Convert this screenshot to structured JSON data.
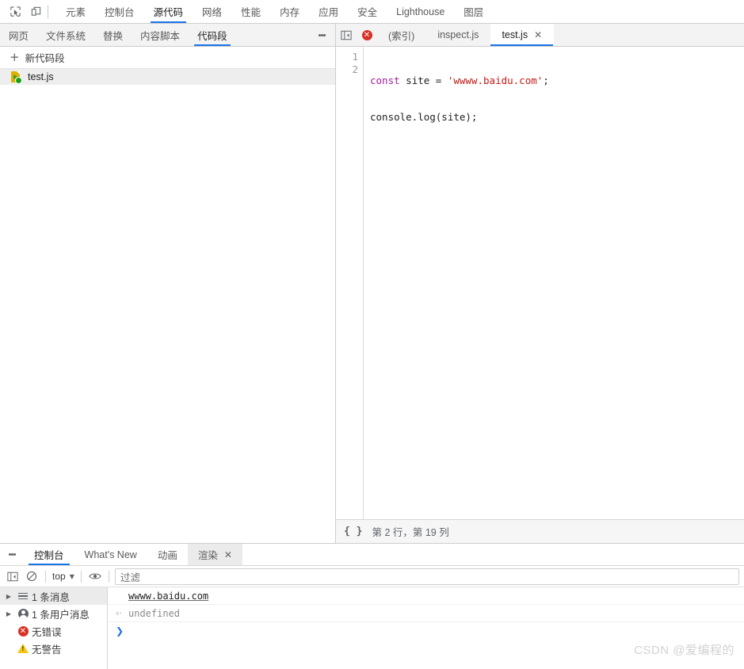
{
  "toolbar": {
    "inspect_icon": "inspect-cursor-icon",
    "device_icon": "device-toolbar-icon"
  },
  "main_tabs": [
    {
      "label": "元素",
      "active": false
    },
    {
      "label": "控制台",
      "active": false
    },
    {
      "label": "源代码",
      "active": true
    },
    {
      "label": "网络",
      "active": false
    },
    {
      "label": "性能",
      "active": false
    },
    {
      "label": "内存",
      "active": false
    },
    {
      "label": "应用",
      "active": false
    },
    {
      "label": "安全",
      "active": false
    },
    {
      "label": "Lighthouse",
      "active": false
    },
    {
      "label": "图层",
      "active": false
    }
  ],
  "navigator": {
    "sub_tabs": [
      {
        "label": "网页",
        "active": false
      },
      {
        "label": "文件系统",
        "active": false
      },
      {
        "label": "替换",
        "active": false
      },
      {
        "label": "内容脚本",
        "active": false
      },
      {
        "label": "代码段",
        "active": true
      }
    ],
    "more_icon": "kebab-menu-icon",
    "new_snippet_label": "新代码段",
    "plus_icon": "plus-icon",
    "files": [
      {
        "name": "test.js",
        "icon": "js-snippet-icon",
        "selected": true
      }
    ]
  },
  "editor": {
    "panel_toggle_icon": "show-navigator-icon",
    "error_badge_icon": "error-circle-icon",
    "tabs": [
      {
        "label": "(索引)",
        "active": false,
        "closable": false
      },
      {
        "label": "inspect.js",
        "active": false,
        "closable": false
      },
      {
        "label": "test.js",
        "active": true,
        "closable": true,
        "close_icon": "close-icon"
      }
    ],
    "line_numbers": [
      "1",
      "2"
    ],
    "code": {
      "line1": {
        "keyword": "const",
        "ident": " site = ",
        "string": "'wwww.baidu.com'",
        "tail": ";"
      },
      "line2": {
        "text": "console.log(site);"
      }
    },
    "status": {
      "format_icon": "pretty-print-braces-icon",
      "cursor_position": "第 2 行，第 19 列"
    }
  },
  "drawer": {
    "more_icon": "kebab-menu-icon",
    "tabs": [
      {
        "label": "控制台",
        "active": true,
        "closable": false
      },
      {
        "label": "What's New",
        "active": false,
        "closable": false
      },
      {
        "label": "动画",
        "active": false,
        "closable": false
      },
      {
        "label": "渲染",
        "active": false,
        "closable": true,
        "close_icon": "close-icon"
      }
    ],
    "console_toolbar": {
      "sidebar_toggle_icon": "console-sidebar-icon",
      "clear_icon": "clear-console-icon",
      "context_label": "top",
      "context_caret": "▼",
      "eye_icon": "live-expression-eye-icon",
      "filter_placeholder": "过滤",
      "filter_value": "过滤"
    },
    "sidebar_items": [
      {
        "label": "1 条消息",
        "icon": "messages-list-icon",
        "expandable": true,
        "selected": true
      },
      {
        "label": "1 条用户消息",
        "icon": "user-message-icon",
        "expandable": true,
        "selected": false
      },
      {
        "label": "无错误",
        "icon": "error-circle-icon",
        "expandable": false,
        "selected": false
      },
      {
        "label": "无警告",
        "icon": "warning-triangle-icon",
        "expandable": false,
        "selected": false
      }
    ],
    "messages": [
      {
        "text": "wwww.baidu.com",
        "style": "link",
        "arrow": ""
      },
      {
        "text": "undefined",
        "style": "dim",
        "arrow": "‹·"
      }
    ],
    "prompt_caret": "❯"
  },
  "watermark": "CSDN @爱编程的",
  "colors": {
    "accent": "#1a73e8",
    "error": "#d93025",
    "warning": "#f5c518",
    "keyword": "#a020a0",
    "string": "#c41a16",
    "js_icon": "#dfb100"
  }
}
